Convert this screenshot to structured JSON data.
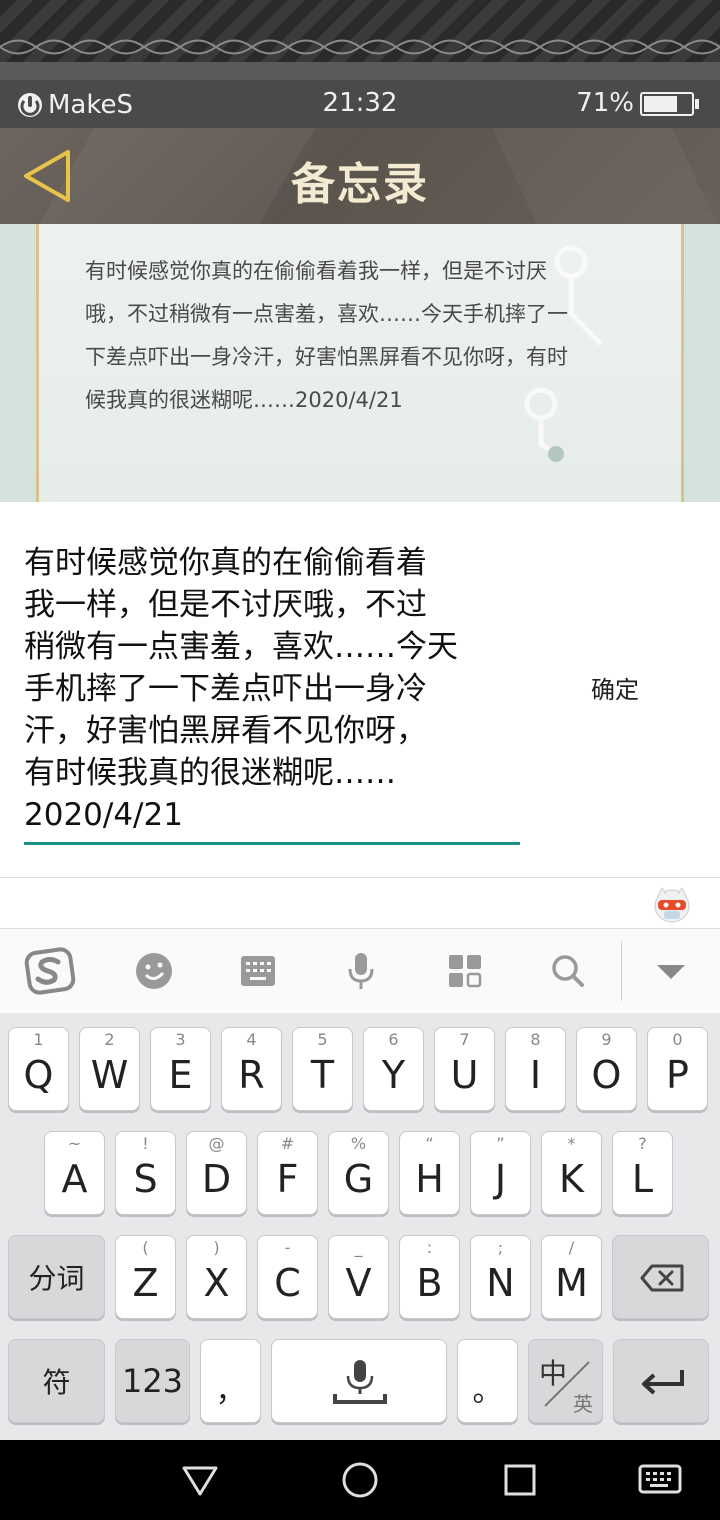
{
  "status_bar": {
    "brand": "MakeS",
    "time": "21:32",
    "battery": "71%",
    "battery_level": 0.71
  },
  "header": {
    "title": "备忘录"
  },
  "memo": {
    "line1": "有时候感觉你真的在偷偷看着我一样，但是不讨厌",
    "line2": "哦，不过稍微有一点害羞，喜欢……今天手机摔了一",
    "line3": "下差点吓出一身冷汗，好害怕黑屏看不见你呀，有时",
    "line4": "候我真的很迷糊呢……2020/4/21"
  },
  "input": {
    "line1": "有时候感觉你真的在偷偷看着",
    "line2": "我一样，但是不讨厌哦，不过",
    "line3": "稍微有一点害羞，喜欢……今天",
    "line4": "手机摔了一下差点吓出一身冷",
    "line5": "汗，好害怕黑屏看不见你呀，",
    "line6": "有时候我真的很迷糊呢……",
    "line7": "2020/4/21",
    "confirm_label": "确定"
  },
  "keyboard": {
    "row1": [
      {
        "main": "Q",
        "sub": "1"
      },
      {
        "main": "W",
        "sub": "2"
      },
      {
        "main": "E",
        "sub": "3"
      },
      {
        "main": "R",
        "sub": "4"
      },
      {
        "main": "T",
        "sub": "5"
      },
      {
        "main": "Y",
        "sub": "6"
      },
      {
        "main": "U",
        "sub": "7"
      },
      {
        "main": "I",
        "sub": "8"
      },
      {
        "main": "O",
        "sub": "9"
      },
      {
        "main": "P",
        "sub": "0"
      }
    ],
    "row2": [
      {
        "main": "A",
        "sub": "~"
      },
      {
        "main": "S",
        "sub": "!"
      },
      {
        "main": "D",
        "sub": "@"
      },
      {
        "main": "F",
        "sub": "#"
      },
      {
        "main": "G",
        "sub": "%"
      },
      {
        "main": "H",
        "sub": "“"
      },
      {
        "main": "J",
        "sub": "”"
      },
      {
        "main": "K",
        "sub": "*"
      },
      {
        "main": "L",
        "sub": "?"
      }
    ],
    "row3": [
      {
        "main": "Z",
        "sub": "("
      },
      {
        "main": "X",
        "sub": ")"
      },
      {
        "main": "C",
        "sub": "-"
      },
      {
        "main": "V",
        "sub": "_"
      },
      {
        "main": "B",
        "sub": ":"
      },
      {
        "main": "N",
        "sub": ";"
      },
      {
        "main": "M",
        "sub": "/"
      }
    ],
    "segment_label": "分词",
    "symbol_label": "符",
    "number_label": "123",
    "comma_label": "，",
    "period_label": "。",
    "lang_main": "中",
    "lang_sub": "英"
  }
}
